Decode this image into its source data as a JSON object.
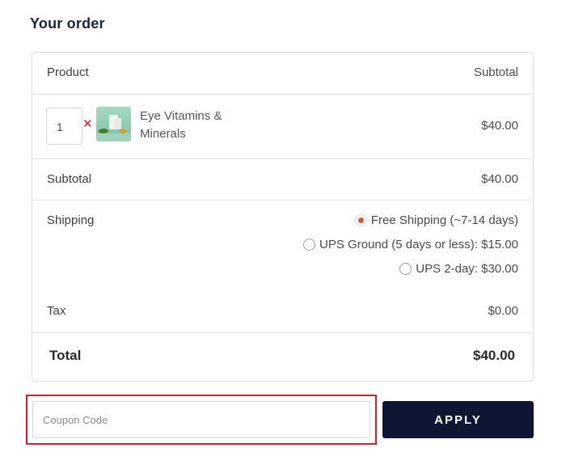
{
  "page": {
    "heading": "Your order"
  },
  "table": {
    "header": {
      "product": "Product",
      "subtotal": "Subtotal"
    },
    "item": {
      "quantity": "1",
      "remove_icon": "close-icon",
      "name": "Eye Vitamins & Minerals",
      "price": "$40.00"
    },
    "subtotal": {
      "label": "Subtotal",
      "value": "$40.00"
    },
    "shipping": {
      "label": "Shipping",
      "options": [
        {
          "label": "Free Shipping (~7-14 days)",
          "selected": true
        },
        {
          "label": "UPS Ground (5 days or less): $15.00",
          "selected": false
        },
        {
          "label": "UPS 2-day: $30.00",
          "selected": false
        }
      ]
    },
    "tax": {
      "label": "Tax",
      "value": "$0.00"
    },
    "total": {
      "label": "Total",
      "value": "$40.00"
    }
  },
  "coupon": {
    "placeholder": "Coupon Code",
    "value": "",
    "apply_label": "APPLY"
  },
  "colors": {
    "accent_radio": "#e5532f",
    "remove": "#e01b1b",
    "button_bg": "#0f1633",
    "highlight": "#e0142b"
  }
}
